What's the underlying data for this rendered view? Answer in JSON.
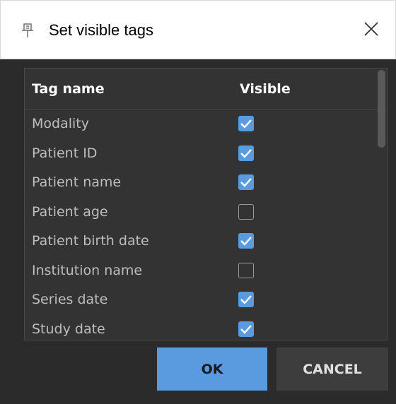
{
  "dialog": {
    "title": "Set visible tags",
    "title_icon": "tag-pin-icon",
    "close_icon": "close-icon"
  },
  "table": {
    "headers": {
      "name": "Tag name",
      "visible": "Visible"
    },
    "rows": [
      {
        "name": "Modality",
        "visible": true
      },
      {
        "name": "Patient ID",
        "visible": true
      },
      {
        "name": "Patient name",
        "visible": true
      },
      {
        "name": "Patient age",
        "visible": false
      },
      {
        "name": "Patient birth date",
        "visible": true
      },
      {
        "name": "Institution name",
        "visible": false
      },
      {
        "name": "Series date",
        "visible": true
      },
      {
        "name": "Study date",
        "visible": true
      }
    ]
  },
  "buttons": {
    "ok": "OK",
    "cancel": "CANCEL"
  },
  "colors": {
    "accent": "#5a9be0",
    "background": "#2b2b2b",
    "text_muted": "#bdbdbd"
  }
}
